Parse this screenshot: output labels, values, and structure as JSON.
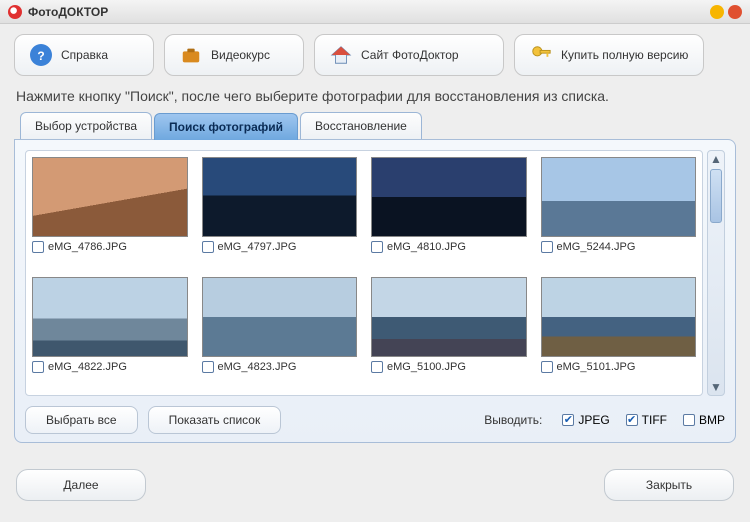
{
  "window": {
    "title": "ФотоДОКТОР"
  },
  "toolbar": {
    "help": "Справка",
    "video": "Видеокурс",
    "site": "Сайт ФотоДоктор",
    "buy": "Купить полную версию"
  },
  "instruction": "Нажмите кнопку \"Поиск\", после чего выберите фотографии для восстановления из списка.",
  "tabs": {
    "device": "Выбор устройства",
    "search": "Поиск фотографий",
    "restore": "Восстановление"
  },
  "thumbs": [
    {
      "file": "eMG_4786.JPG"
    },
    {
      "file": "eMG_4797.JPG"
    },
    {
      "file": "eMG_4810.JPG"
    },
    {
      "file": "eMG_5244.JPG"
    },
    {
      "file": "eMG_4822.JPG"
    },
    {
      "file": "eMG_4823.JPG"
    },
    {
      "file": "eMG_5100.JPG"
    },
    {
      "file": "eMG_5101.JPG"
    }
  ],
  "panel": {
    "select_all": "Выбрать все",
    "show_list": "Показать список",
    "output_label": "Выводить:",
    "filters": {
      "jpeg": "JPEG",
      "tiff": "TIFF",
      "bmp": "BMP"
    }
  },
  "footer": {
    "next": "Далее",
    "close": "Закрыть"
  }
}
